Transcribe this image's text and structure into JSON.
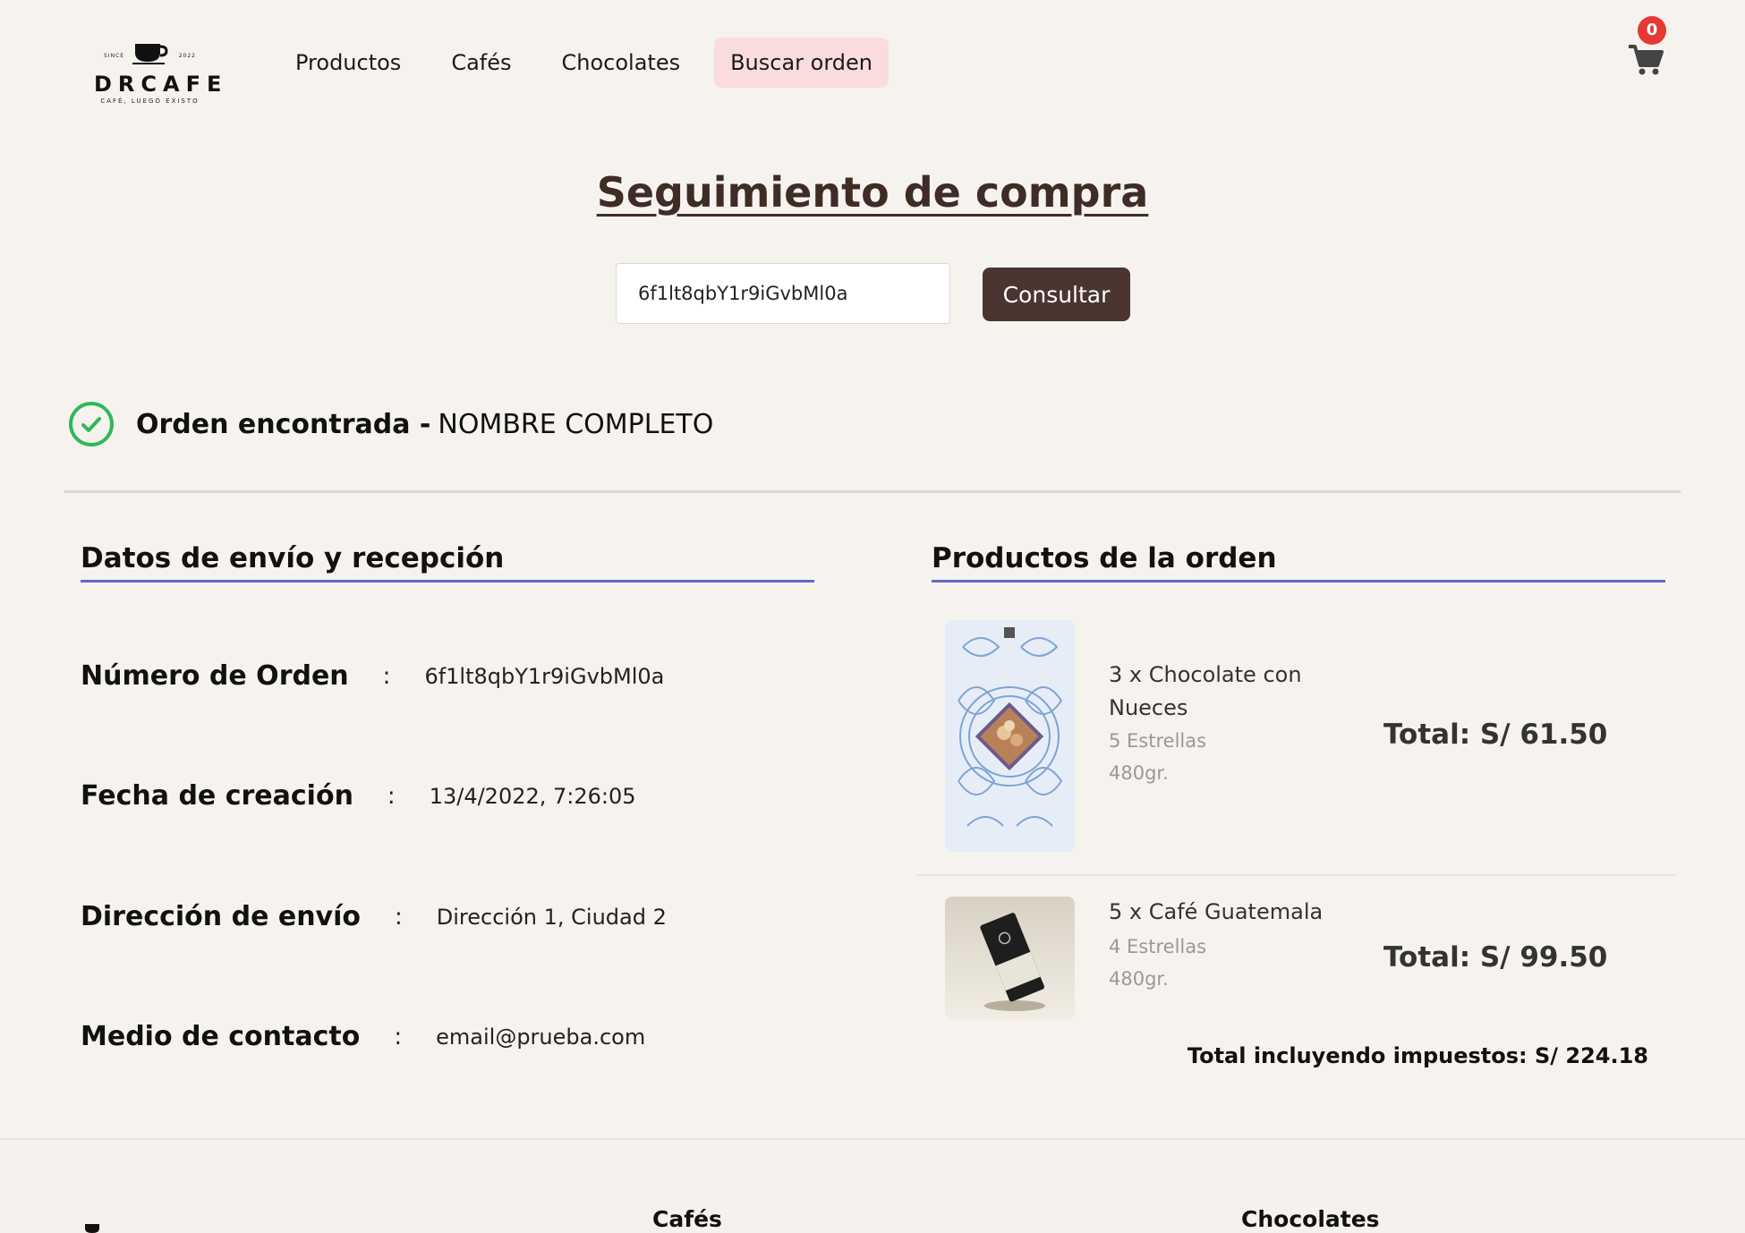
{
  "header": {
    "logo": {
      "brand": "DRCAFE",
      "since": "SINCE",
      "year": "2022",
      "tagline": "CAFÉ, LUEGO EXISTO"
    },
    "nav": [
      {
        "label": "Productos",
        "active": false
      },
      {
        "label": "Cafés",
        "active": false
      },
      {
        "label": "Chocolates",
        "active": false
      },
      {
        "label": "Buscar orden",
        "active": true
      }
    ],
    "cart_count": "0"
  },
  "search": {
    "title": "Seguimiento de compra",
    "input_value": "6f1lt8qbY1r9iGvbMl0a",
    "button_label": "Consultar"
  },
  "result": {
    "status_label": "Orden encontrada -",
    "customer_name": "NOMBRE COMPLETO"
  },
  "shipping": {
    "title": "Datos de envío y recepción",
    "rows": [
      {
        "label": "Número de Orden",
        "value": "6f1lt8qbY1r9iGvbMl0a"
      },
      {
        "label": "Fecha de creación",
        "value": "13/4/2022, 7:26:05"
      },
      {
        "label": "Dirección de envío",
        "value": "Dirección 1, Ciudad 2"
      },
      {
        "label": "Medio de contacto",
        "value": "email@prueba.com"
      }
    ],
    "colon": ":"
  },
  "products": {
    "title": "Productos de la orden",
    "items": [
      {
        "name": "3 x Chocolate con Nueces",
        "rating": "5 Estrellas",
        "weight": "480gr.",
        "total": "Total: S/ 61.50",
        "image_icon": "chocolate-package-image"
      },
      {
        "name": "5 x Café Guatemala",
        "rating": "4 Estrellas",
        "weight": "480gr.",
        "total": "Total: S/ 99.50",
        "image_icon": "coffee-bag-image"
      }
    ],
    "grand_total": "Total incluyendo impuestos: S/ 224.18"
  },
  "footer": {
    "columns": [
      "Cafés",
      "Chocolates"
    ]
  },
  "colors": {
    "background": "#f6f3ef",
    "primary_button": "#4a3530",
    "active_nav": "#fadcdc",
    "section_underline": "#6169c8",
    "success": "#2eb85c",
    "badge": "#e53935"
  }
}
